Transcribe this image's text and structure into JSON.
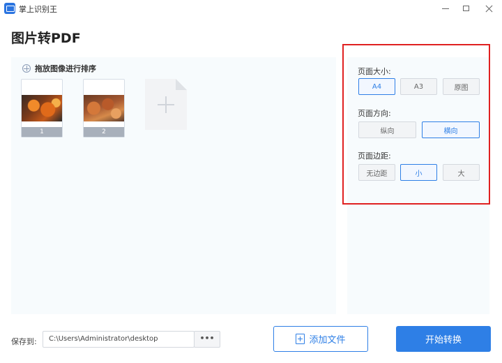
{
  "window": {
    "title": "掌上识别王"
  },
  "page": {
    "title": "图片转PDF"
  },
  "images_panel": {
    "sort_hint": "拖放图像进行排序",
    "thumbnails": [
      {
        "label": "1"
      },
      {
        "label": "2"
      }
    ]
  },
  "settings": {
    "page_size": {
      "label": "页面大小:",
      "options": [
        "A4",
        "A3",
        "原图"
      ],
      "selected": "A4"
    },
    "orientation": {
      "label": "页面方向:",
      "options": [
        "纵向",
        "横向"
      ],
      "selected": "横向"
    },
    "margin": {
      "label": "页面边距:",
      "options": [
        "无边距",
        "小",
        "大"
      ],
      "selected": "小"
    }
  },
  "footer": {
    "save_label": "保存到:",
    "save_path": "C:\\Users\\Administrator\\desktop",
    "browse_label": "•••",
    "add_file_label": "添加文件",
    "start_label": "开始转换"
  },
  "colors": {
    "accent": "#2e7fe6",
    "highlight_border": "#e02020",
    "panel_bg": "#f7fbfd"
  }
}
